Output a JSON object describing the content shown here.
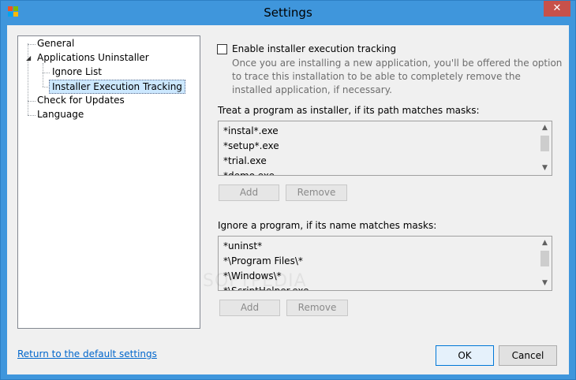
{
  "window": {
    "title": "Settings",
    "close_glyph": "✕",
    "logo_colors": [
      "#f25022",
      "#7fba00",
      "#00a4ef",
      "#ffb900"
    ]
  },
  "tree": {
    "expander_glyph": "◢",
    "items": [
      {
        "label": "General"
      },
      {
        "label": "Applications Uninstaller"
      },
      {
        "label": "Ignore List"
      },
      {
        "label": "Installer Execution Tracking",
        "selected": true
      },
      {
        "label": "Check for Updates"
      },
      {
        "label": "Language"
      }
    ]
  },
  "tracking": {
    "checkbox_label": "Enable installer execution tracking",
    "checked": false,
    "description": "Once you are installing a new application, you'll be offered the option to trace this installation to be able to completely remove the installed application, if necessary."
  },
  "installer_masks": {
    "label": "Treat a program as installer, if its path matches masks:",
    "items": [
      "*instal*.exe",
      "*setup*.exe",
      "*trial.exe",
      "*demo.exe"
    ],
    "add_label": "Add",
    "remove_label": "Remove"
  },
  "ignore_masks": {
    "label": "Ignore a program, if its name matches masks:",
    "items": [
      "*uninst*",
      "*\\Program Files\\*",
      "*\\Windows\\*",
      "*\\ScriptHelper.exe"
    ],
    "add_label": "Add",
    "remove_label": "Remove"
  },
  "scrollbar": {
    "up": "▲",
    "down": "▼"
  },
  "footer": {
    "reset_link": "Return to the default settings",
    "ok_label": "OK",
    "cancel_label": "Cancel"
  },
  "watermark": "SOFTPEDIA"
}
